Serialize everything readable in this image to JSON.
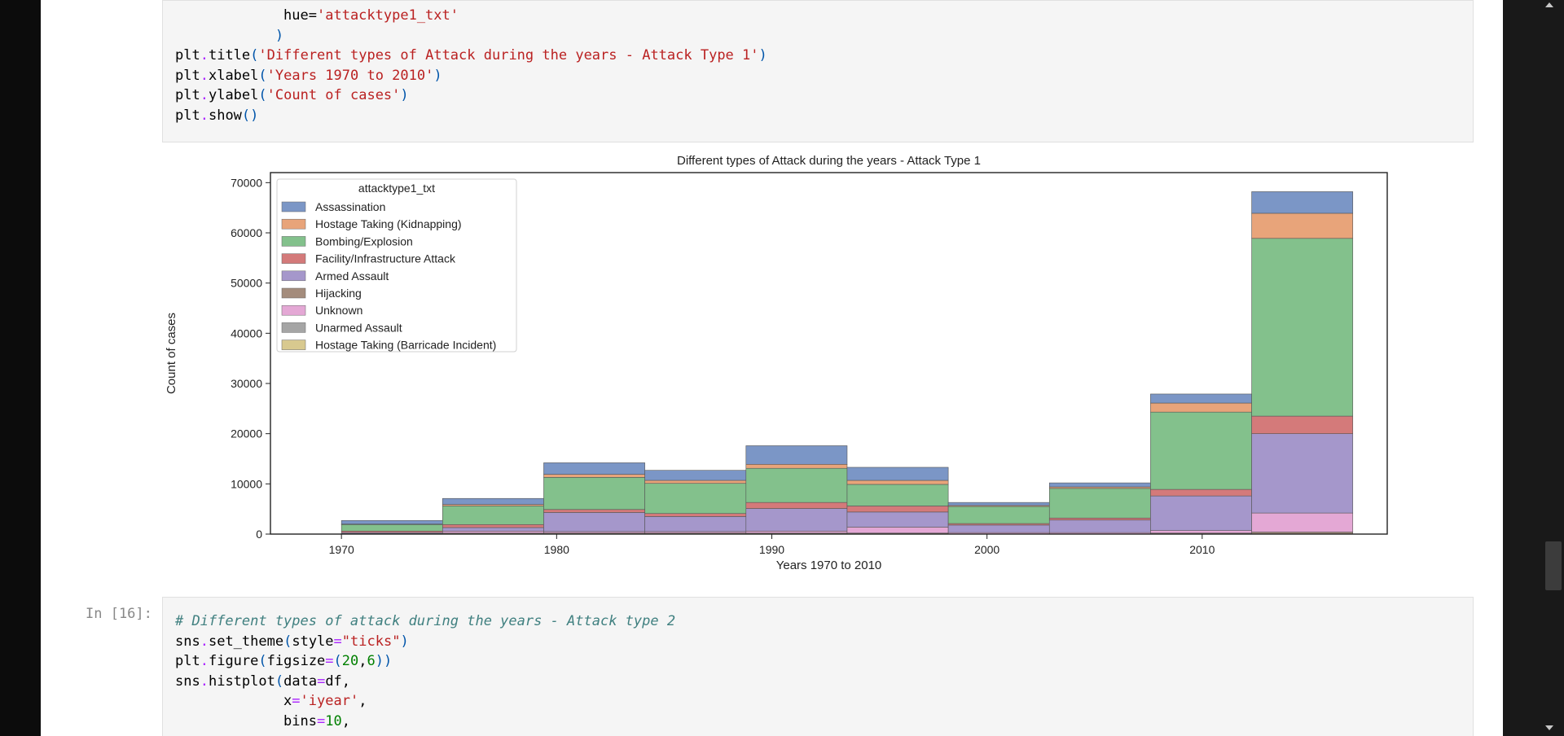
{
  "cells": {
    "top_code": [
      "             hue='attacktype1_txt'",
      "            )",
      "plt.title('Different types of Attack during the years - Attack Type 1')",
      "plt.xlabel('Years 1970 to 2010')",
      "plt.ylabel('Count of cases')",
      "plt.show()"
    ],
    "next_prompt": "In [16]:",
    "next_code": [
      "# Different types of attack during the years - Attack type 2",
      "sns.set_theme(style=\"ticks\")",
      "plt.figure(figsize=(20,6))",
      "sns.histplot(data=df,",
      "             x='iyear',",
      "             bins=10,"
    ]
  },
  "colors": {
    "Assassination": "#7b96c6",
    "Hostage Taking (Kidnapping)": "#e8a47a",
    "Bombing/Explosion": "#83c18c",
    "Facility/Infrastructure Attack": "#d47a7a",
    "Armed Assault": "#a597cb",
    "Hijacking": "#a48c7c",
    "Unknown": "#e4a8d5",
    "Unarmed Assault": "#a5a5a5",
    "Hostage Taking (Barricade Incident)": "#d8c98f"
  },
  "chart_data": {
    "type": "bar",
    "title": "Different types of Attack during the years - Attack Type 1",
    "xlabel": "Years 1970 to 2010",
    "ylabel": "Count of cases",
    "xlim": [
      1966.7,
      2018.6
    ],
    "ylim": [
      0,
      72000
    ],
    "xticks": [
      1970,
      1980,
      1990,
      2000,
      2010
    ],
    "yticks": [
      0,
      10000,
      20000,
      30000,
      40000,
      50000,
      60000,
      70000
    ],
    "legend_title": "attacktype1_txt",
    "legend_position": "upper-left",
    "stacking": "stacked",
    "bins": [
      {
        "x0": 1970.0,
        "x1": 1974.7
      },
      {
        "x0": 1974.7,
        "x1": 1979.4
      },
      {
        "x0": 1979.4,
        "x1": 1984.1
      },
      {
        "x0": 1984.1,
        "x1": 1988.8
      },
      {
        "x0": 1988.8,
        "x1": 1993.5
      },
      {
        "x0": 1993.5,
        "x1": 1998.2
      },
      {
        "x0": 1998.2,
        "x1": 2002.9
      },
      {
        "x0": 2002.9,
        "x1": 2007.6
      },
      {
        "x0": 2007.6,
        "x1": 2012.3
      },
      {
        "x0": 2012.3,
        "x1": 2017.0
      }
    ],
    "series": [
      {
        "name": "Hostage Taking (Barricade Incident)",
        "values": [
          0,
          0,
          0,
          0,
          0,
          0,
          0,
          0,
          0,
          0
        ]
      },
      {
        "name": "Unarmed Assault",
        "values": [
          0,
          0,
          0,
          0,
          0,
          0,
          0,
          0,
          0,
          0
        ]
      },
      {
        "name": "Hijacking",
        "values": [
          0,
          200,
          200,
          200,
          200,
          200,
          0,
          0,
          200,
          400
        ]
      },
      {
        "name": "Unknown",
        "values": [
          100,
          400,
          300,
          300,
          400,
          1200,
          300,
          300,
          500,
          3800
        ]
      },
      {
        "name": "Armed Assault",
        "values": [
          200,
          700,
          3800,
          3000,
          4500,
          3000,
          1500,
          2500,
          6900,
          15800
        ]
      },
      {
        "name": "Facility/Infrastructure Attack",
        "values": [
          300,
          600,
          600,
          600,
          1200,
          1200,
          300,
          400,
          1300,
          3500
        ]
      },
      {
        "name": "Bombing/Explosion",
        "values": [
          1300,
          3700,
          6400,
          6000,
          6800,
          4300,
          3400,
          5900,
          15400,
          35400
        ]
      },
      {
        "name": "Hostage Taking (Kidnapping)",
        "values": [
          100,
          300,
          600,
          600,
          800,
          800,
          200,
          300,
          1800,
          5000
        ]
      },
      {
        "name": "Assassination",
        "values": [
          700,
          1200,
          2300,
          2000,
          3700,
          2600,
          600,
          800,
          1800,
          4300
        ]
      }
    ]
  }
}
